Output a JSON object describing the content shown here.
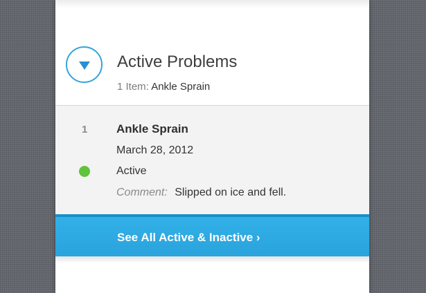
{
  "section": {
    "title": "Active Problems",
    "item_count_label": "1 Item:",
    "item_count_value": "Ankle Sprain",
    "toggle_icon": "chevron-down-icon"
  },
  "problems": [
    {
      "number": "1",
      "name": "Ankle Sprain",
      "date": "March 28, 2012",
      "status": "Active",
      "status_color": "#5fc33c",
      "comment_label": "Comment:",
      "comment": "Slipped on ice and fell."
    }
  ],
  "see_all": {
    "label": "See All Active & Inactive ›"
  },
  "colors": {
    "accent": "#33a4dc",
    "button": "#2aa3dc",
    "background": "#63666d"
  }
}
